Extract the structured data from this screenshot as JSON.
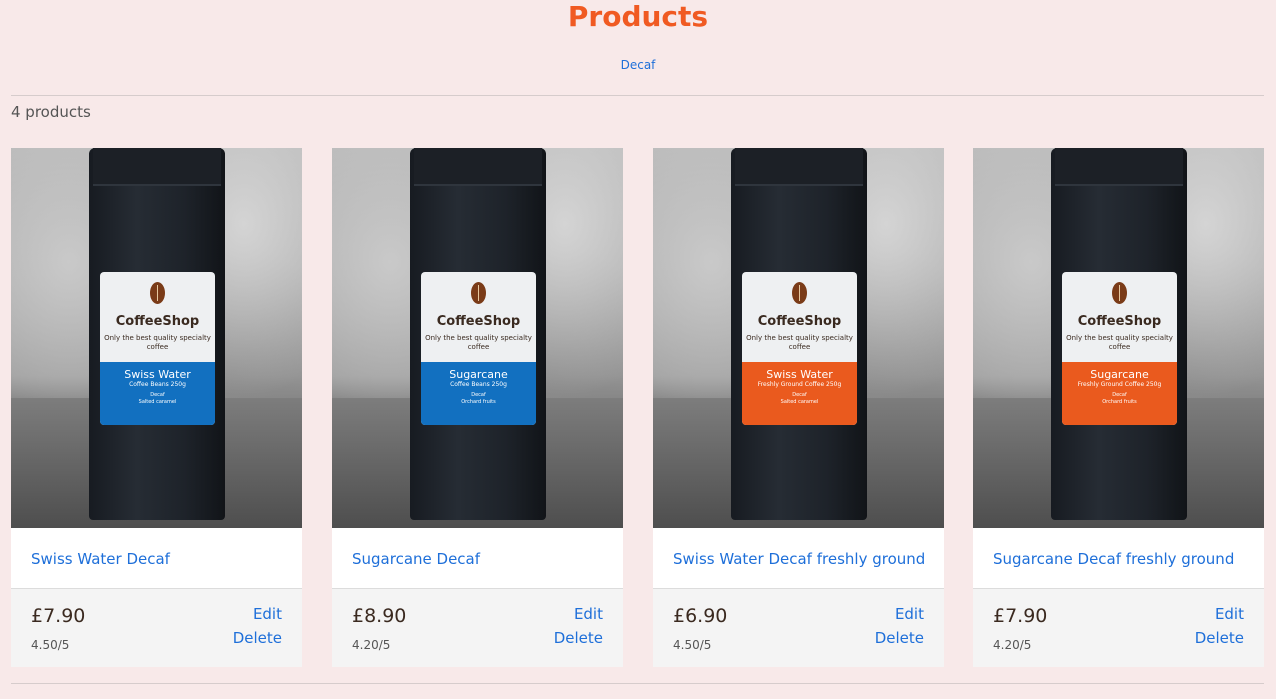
{
  "page": {
    "title": "Products",
    "category": "Decaf",
    "product_count": "4 products"
  },
  "colors": {
    "background": "#f8e9e9",
    "title": "#f05a22",
    "link": "#1e6fd9",
    "label_blue": "#1270c0",
    "label_orange": "#ea5a1e"
  },
  "products": [
    {
      "name": "Swiss Water Decaf",
      "price": "£7.90",
      "rating": "4.50/5",
      "edit_label": "Edit",
      "delete_label": "Delete",
      "bag": {
        "brand": "CoffeeShop",
        "tagline": "Only the best quality specialty coffee",
        "variety": "Swiss Water",
        "format": "Coffee Beans 250g",
        "note1": "Decaf",
        "note2": "Salted caramel",
        "band_color": "blue"
      }
    },
    {
      "name": "Sugarcane Decaf",
      "price": "£8.90",
      "rating": "4.20/5",
      "edit_label": "Edit",
      "delete_label": "Delete",
      "bag": {
        "brand": "CoffeeShop",
        "tagline": "Only the best quality specialty coffee",
        "variety": "Sugarcane",
        "format": "Coffee Beans 250g",
        "note1": "Decaf",
        "note2": "Orchard fruits",
        "band_color": "blue"
      }
    },
    {
      "name": "Swiss Water Decaf freshly ground",
      "price": "£6.90",
      "rating": "4.50/5",
      "edit_label": "Edit",
      "delete_label": "Delete",
      "bag": {
        "brand": "CoffeeShop",
        "tagline": "Only the best quality specialty coffee",
        "variety": "Swiss Water",
        "format": "Freshly Ground Coffee 250g",
        "note1": "Decaf",
        "note2": "Salted caramel",
        "band_color": "orange"
      }
    },
    {
      "name": "Sugarcane Decaf freshly ground",
      "price": "£7.90",
      "rating": "4.20/5",
      "edit_label": "Edit",
      "delete_label": "Delete",
      "bag": {
        "brand": "CoffeeShop",
        "tagline": "Only the best quality specialty coffee",
        "variety": "Sugarcane",
        "format": "Freshly Ground Coffee 250g",
        "note1": "Decaf",
        "note2": "Orchard fruits",
        "band_color": "orange"
      }
    }
  ]
}
